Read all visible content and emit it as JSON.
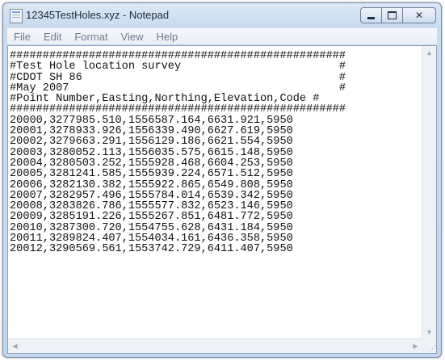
{
  "window": {
    "title": "12345TestHoles.xyz - Notepad",
    "accent_color": "#c9dbef"
  },
  "menu": {
    "items": [
      {
        "label": "File"
      },
      {
        "label": "Edit"
      },
      {
        "label": "Format"
      },
      {
        "label": "View"
      },
      {
        "label": "Help"
      }
    ]
  },
  "document": {
    "lines": [
      "###################################################",
      "#Test Hole location survey                        #",
      "#CDOT SH 86                                       #",
      "#May 2007                                         #",
      "#Point Number,Easting,Northing,Elevation,Code #",
      "###################################################",
      "20000,3277985.510,1556587.164,6631.921,5950",
      "20001,3278933.926,1556339.490,6627.619,5950",
      "20002,3279663.291,1556129.186,6621.554,5950",
      "20003,3280052.113,1556035.575,6615.148,5950",
      "20004,3280503.252,1555928.468,6604.253,5950",
      "20005,3281241.585,1555939.224,6571.512,5950",
      "20006,3282130.382,1555922.865,6549.808,5950",
      "20007,3282957.496,1555784.014,6539.342,5950",
      "20008,3283826.786,1555577.832,6523.146,5950",
      "20009,3285191.226,1555267.851,6481.772,5950",
      "20010,3287300.720,1554755.628,6431.184,5950",
      "20011,3289824.407,1554034.161,6436.358,5950",
      "20012,3290569.561,1553742.729,6411.407,5950"
    ]
  },
  "icons": {
    "app": "notepad-icon",
    "minimize": "minimize-icon",
    "maximize": "maximize-icon",
    "close": "close-icon",
    "close_glyph": "✕"
  }
}
